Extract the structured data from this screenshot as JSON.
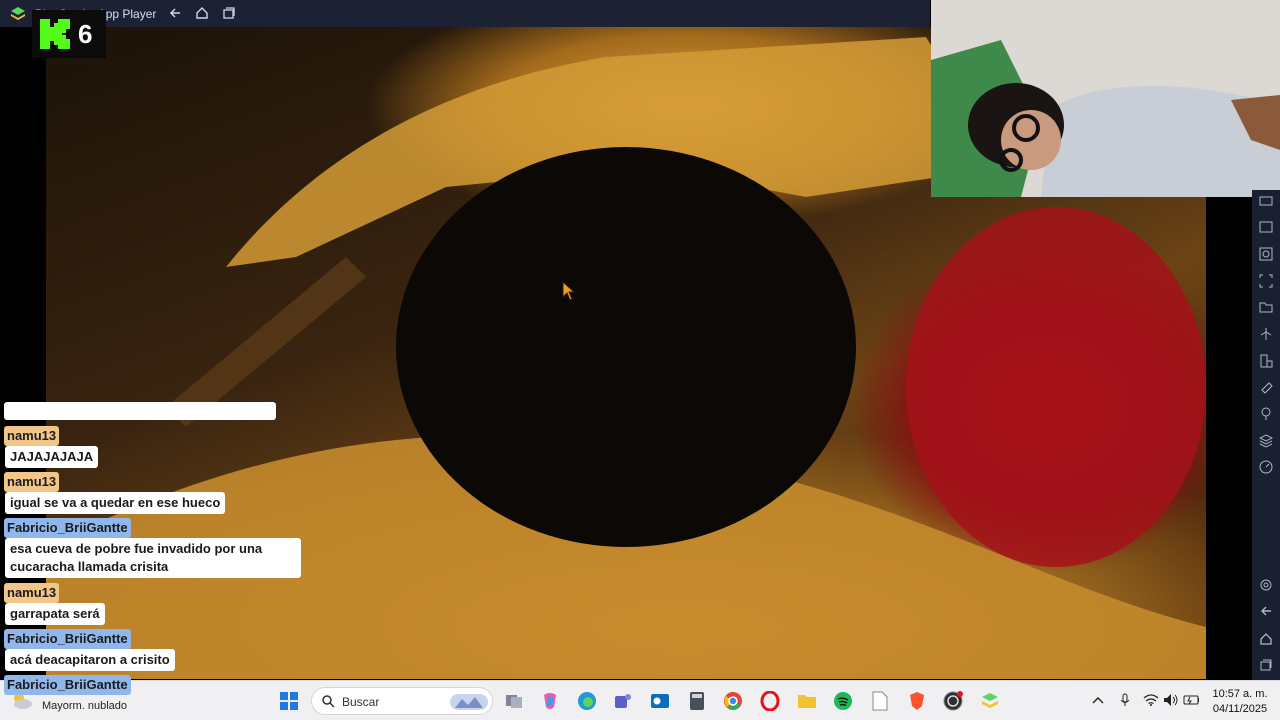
{
  "window": {
    "title": "BlueStacks App Player"
  },
  "overlay": {
    "channel_number": "6"
  },
  "chat": {
    "messages": [
      {
        "user": "namu13",
        "color": "orange",
        "text": "JAJAJAJAJA"
      },
      {
        "user": "namu13",
        "color": "orange",
        "text": "igual se va a quedar en ese hueco"
      },
      {
        "user": "Fabricio_BriiGantte",
        "color": "blue",
        "text_line1": "esa cueva de pobre fue invadido por una",
        "text_line2": "cucaracha llamada crisita"
      },
      {
        "user": "namu13",
        "color": "orange",
        "text": "garrapata será"
      },
      {
        "user": "Fabricio_BriiGantte",
        "color": "blue",
        "text": "acá deacapitaron a crisito"
      },
      {
        "user": "Fabricio_BriiGantte",
        "color": "blue"
      }
    ]
  },
  "taskbar": {
    "weather": "Mayorm. nublado",
    "search_label": "Buscar",
    "time": "10:57 a. m.",
    "date": "04/11/2025"
  },
  "colors": {
    "user_orange": "#f2c589",
    "user_blue": "#8fb7ec",
    "kick_green": "#53fc18"
  }
}
